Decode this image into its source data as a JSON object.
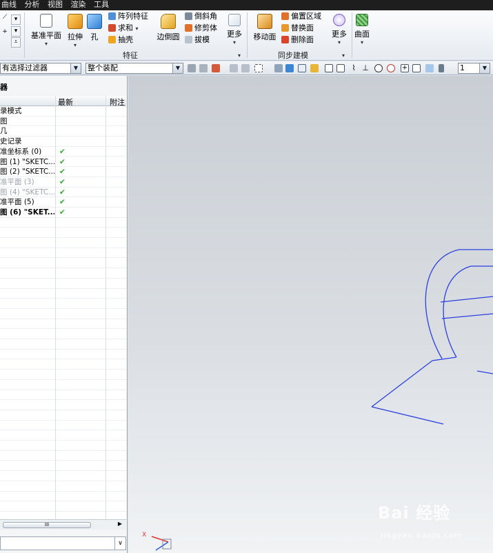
{
  "menubar": {
    "items": [
      "曲线",
      "分析",
      "视图",
      "渲染",
      "工具"
    ]
  },
  "ribbon": {
    "feature_group": {
      "label": "特征",
      "datum_plane": "基准平面",
      "extrude": "拉伸",
      "hole": "孔",
      "pattern_feature": "阵列特征",
      "unite": "求和",
      "shell": "抽壳",
      "edge_blend": "边倒圆",
      "chamfer": "倒斜角",
      "trim_body": "修剪体",
      "draft": "拔模",
      "more": "更多"
    },
    "sync_group": {
      "label": "同步建模",
      "move_face": "移动面",
      "offset_region": "偏置区域",
      "replace_face": "替换面",
      "delete_face": "删除面",
      "more": "更多"
    },
    "surface": "曲面"
  },
  "toolbar": {
    "filter": "有选择过滤器",
    "assembly_scope": "整个装配",
    "layer_value": "1"
  },
  "navigator": {
    "title": "器",
    "columns": {
      "latest": "最新",
      "notes": "附注"
    },
    "rows": [
      {
        "name": "录模式",
        "check": "",
        "dim": false,
        "bold": false
      },
      {
        "name": "图",
        "check": "",
        "dim": false,
        "bold": false
      },
      {
        "name": "几",
        "check": "",
        "dim": false,
        "bold": false
      },
      {
        "name": "史记录",
        "check": "",
        "dim": false,
        "bold": false
      },
      {
        "name": "准坐标系 (0)",
        "check": "✔",
        "dim": false,
        "bold": false
      },
      {
        "name": "图 (1) \"SKETC...",
        "check": "✔",
        "dim": false,
        "bold": false
      },
      {
        "name": "图 (2) \"SKETC...",
        "check": "✔",
        "dim": false,
        "bold": false
      },
      {
        "name": "准平面 (3)",
        "check": "✔",
        "dim": true,
        "bold": false
      },
      {
        "name": "图 (4) \"SKETC...",
        "check": "✔",
        "dim": true,
        "bold": false
      },
      {
        "name": "准平面 (5)",
        "check": "✔",
        "dim": false,
        "bold": false
      },
      {
        "name": "图 (6) \"SKET...",
        "check": "✔",
        "dim": false,
        "bold": true
      }
    ],
    "scroll_label": "III"
  },
  "viewport": {
    "triad_label": "X",
    "watermark": "Bai 经验",
    "watermark_url": "jingyan.baidu.com"
  },
  "colors": {
    "sketch_curve": "#2a3fe0",
    "check": "#2fa82f"
  }
}
